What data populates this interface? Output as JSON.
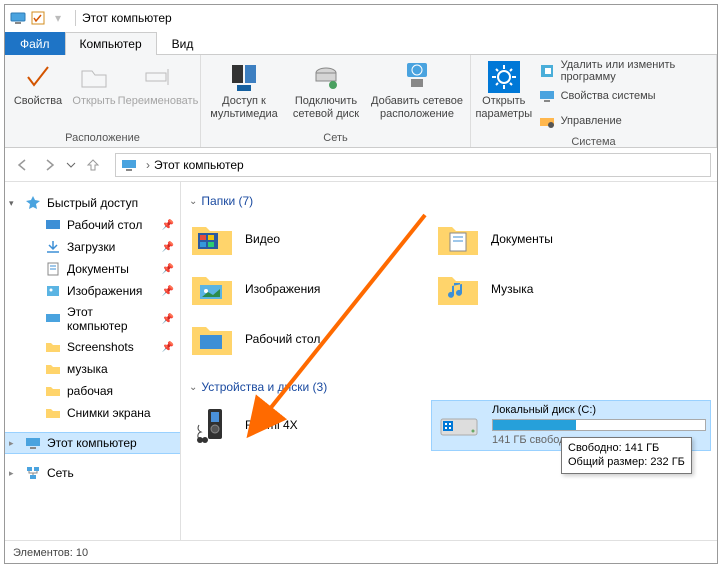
{
  "window": {
    "title": "Этот компьютер"
  },
  "tabs": {
    "file": "Файл",
    "computer": "Компьютер",
    "view": "Вид"
  },
  "ribbon": {
    "location": {
      "props": "Свойства",
      "open": "Открыть",
      "rename": "Переименовать",
      "group": "Расположение"
    },
    "network": {
      "media": "Доступ к\nмультимедиа",
      "netdrive": "Подключить\nсетевой диск",
      "addnet": "Добавить сетевое\nрасположение",
      "group": "Сеть"
    },
    "system": {
      "settings": "Открыть\nпараметры",
      "uninstall": "Удалить или изменить программу",
      "sysprops": "Свойства системы",
      "manage": "Управление",
      "group": "Система"
    }
  },
  "breadcrumb": {
    "root": "Этот компьютер"
  },
  "sidebar": {
    "quick": "Быстрый доступ",
    "items": [
      {
        "label": "Рабочий стол",
        "pinned": true
      },
      {
        "label": "Загрузки",
        "pinned": true
      },
      {
        "label": "Документы",
        "pinned": true
      },
      {
        "label": "Изображения",
        "pinned": true
      },
      {
        "label": "Этот компьютер",
        "pinned": true
      },
      {
        "label": "Screenshots",
        "pinned": true
      },
      {
        "label": "музыка",
        "pinned": false
      },
      {
        "label": "рабочая",
        "pinned": false
      },
      {
        "label": "Снимки экрана",
        "pinned": false
      }
    ],
    "thispc": "Этот компьютер",
    "network": "Сеть"
  },
  "content": {
    "folders_header": "Папки (7)",
    "folders": [
      {
        "label": "Видео"
      },
      {
        "label": "Документы"
      },
      {
        "label": "Изображения"
      },
      {
        "label": "Музыка"
      },
      {
        "label": "Рабочий стол"
      }
    ],
    "drives_header": "Устройства и диски (3)",
    "device": {
      "label": "Redmi 4X"
    },
    "localdisk": {
      "label": "Локальный диск (C:)",
      "free_text": "141 ГБ свободно",
      "percent_used": 39
    },
    "tooltip": {
      "line1": "Свободно: 141 ГБ",
      "line2": "Общий размер: 232 ГБ"
    }
  },
  "status": {
    "items": "Элементов: 10"
  }
}
